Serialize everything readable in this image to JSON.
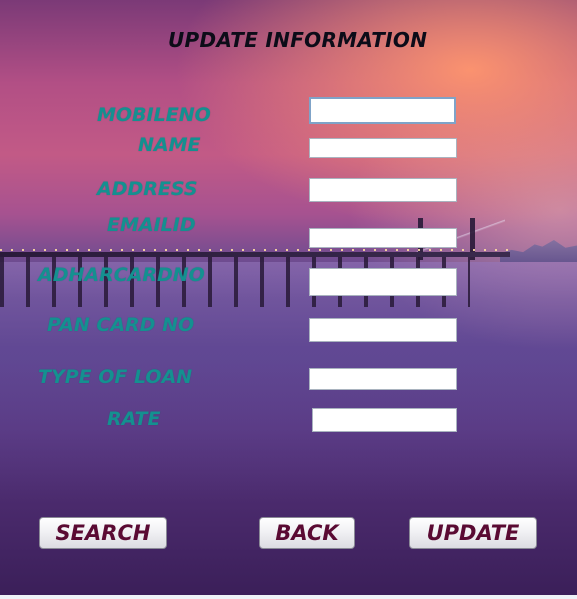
{
  "title": "UPDATE INFORMATION",
  "fields": {
    "mobileno": {
      "label": "MOBILENO",
      "value": ""
    },
    "name": {
      "label": "NAME",
      "value": ""
    },
    "address": {
      "label": "ADDRESS",
      "value": ""
    },
    "emailid": {
      "label": "EMAILID",
      "value": ""
    },
    "adharcardno": {
      "label": "ADHARCARDNO",
      "value": ""
    },
    "pancardno": {
      "label": "PAN CARD NO",
      "value": ""
    },
    "typeofloan": {
      "label": "TYPE OF LOAN",
      "value": ""
    },
    "rate": {
      "label": "RATE",
      "value": ""
    }
  },
  "buttons": {
    "search": "SEARCH",
    "back": "BACK",
    "update": "UPDATE"
  },
  "colors": {
    "label": "#149090",
    "button_text": "#5a0a33",
    "title": "#0c0c18"
  }
}
